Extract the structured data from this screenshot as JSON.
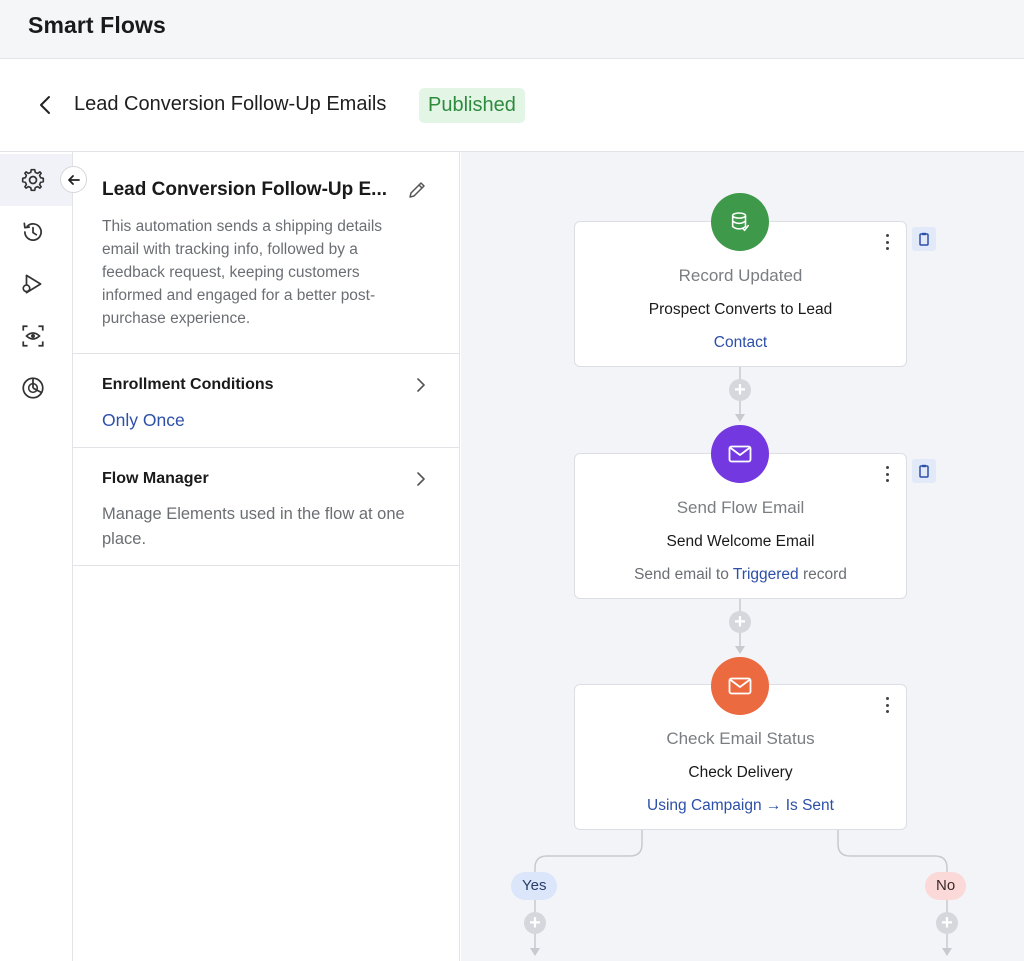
{
  "app": {
    "title": "Smart Flows"
  },
  "header": {
    "flow_title": "Lead Conversion Follow-Up Emails",
    "status": "Published",
    "status_color": "#2e8b3e"
  },
  "icon_rail": {
    "items": [
      {
        "icon": "gear-icon",
        "active": true
      },
      {
        "icon": "history-icon",
        "active": false
      },
      {
        "icon": "run-flow-icon",
        "active": false
      },
      {
        "icon": "preview-eye-icon",
        "active": false
      },
      {
        "icon": "analytics-icon",
        "active": false
      }
    ]
  },
  "panel": {
    "name": "Lead Conversion Follow-Up E...",
    "description": "This automation sends a shipping details email with tracking info, followed by a feedback request, keeping customers informed and engaged for a better post-purchase experience.",
    "enrollment": {
      "title": "Enrollment Conditions",
      "value": "Only Once"
    },
    "flow_manager": {
      "title": "Flow Manager",
      "description": "Manage Elements used in the flow at one place."
    }
  },
  "canvas": {
    "nodes": [
      {
        "type": "Record Updated",
        "name": "Prospect Converts to Lead",
        "detail_link": "Contact",
        "icon": "database-icon",
        "color": "#3e9a4a"
      },
      {
        "type": "Send Flow Email",
        "name": "Send Welcome Email",
        "detail_prefix": "Send email to ",
        "detail_link": "Triggered",
        "detail_suffix": " record",
        "icon": "envelope-icon",
        "color": "#7438e0"
      },
      {
        "type": "Check Email Status",
        "name": "Check Delivery",
        "detail_link": "Using Campaign → Is Sent",
        "icon": "envelope-icon",
        "color": "#ec6a3f"
      }
    ],
    "branches": [
      {
        "label": "Yes",
        "bg": "#dbe6fb",
        "color": "#2a3c6a"
      },
      {
        "label": "No",
        "bg": "#fbd9d8",
        "color": "#3a2a2a"
      }
    ],
    "add_symbol": "+"
  }
}
